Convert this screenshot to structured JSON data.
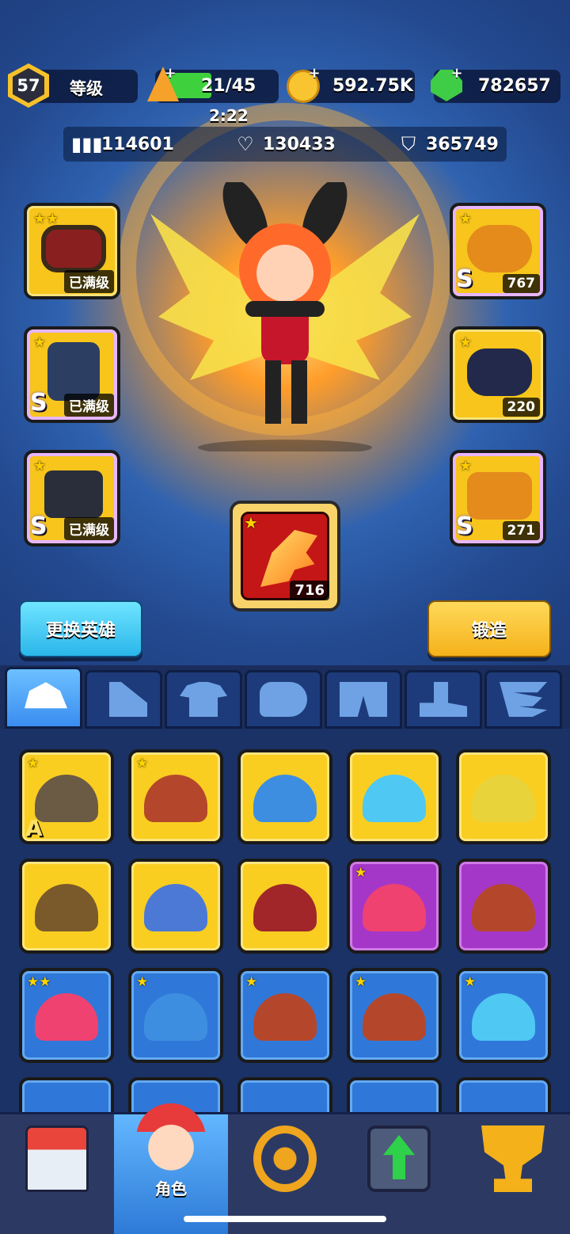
{
  "header": {
    "level": "57",
    "level_label": "等级",
    "energy": "21/45",
    "energy_fill_fraction": 0.47,
    "energy_timer": "2:22",
    "coins": "592.75K",
    "gems": "782657"
  },
  "stats": {
    "attack": "114601",
    "health": "130433",
    "defense": "365749"
  },
  "equipment": {
    "left": [
      {
        "name": "goggles",
        "stars": "★★",
        "tag": "已满级",
        "grade": ""
      },
      {
        "name": "vest",
        "stars": "★",
        "tag": "已满级",
        "grade": "S"
      },
      {
        "name": "belt",
        "stars": "★",
        "tag": "已满级",
        "grade": "S"
      }
    ],
    "right": [
      {
        "name": "helmet",
        "stars": "★",
        "tag": "767",
        "grade": "S"
      },
      {
        "name": "gloves",
        "stars": "★",
        "tag": "220",
        "grade": ""
      },
      {
        "name": "boots",
        "stars": "★",
        "tag": "271",
        "grade": "S"
      }
    ],
    "weapon": {
      "stars": "★",
      "tag": "716"
    }
  },
  "buttons": {
    "change_hero": "更换英雄",
    "forge": "锻造"
  },
  "tabs": [
    "hat",
    "shirt-left",
    "shirt",
    "gloves",
    "pants",
    "boots",
    "wings"
  ],
  "inventory": [
    {
      "rarity": "yellow",
      "item": "army-helmet",
      "stars": "★",
      "grade": "A"
    },
    {
      "rarity": "yellow",
      "item": "cowboy-hat",
      "stars": "★",
      "grade": ""
    },
    {
      "rarity": "yellow",
      "item": "police-cap",
      "stars": "",
      "grade": ""
    },
    {
      "rarity": "yellow",
      "item": "ski-goggles",
      "stars": "",
      "grade": ""
    },
    {
      "rarity": "yellow",
      "item": "miner-helmet",
      "stars": "",
      "grade": ""
    },
    {
      "rarity": "yellow",
      "item": "steampunk-goggles",
      "stars": "",
      "grade": ""
    },
    {
      "rarity": "yellow",
      "item": "swat-helmet",
      "stars": "",
      "grade": ""
    },
    {
      "rarity": "yellow",
      "item": "red-goggles",
      "stars": "",
      "grade": ""
    },
    {
      "rarity": "purple",
      "item": "headphones",
      "stars": "★",
      "grade": ""
    },
    {
      "rarity": "purple",
      "item": "cowboy-hat",
      "stars": "",
      "grade": ""
    },
    {
      "rarity": "blue",
      "item": "headphones",
      "stars": "★★",
      "grade": ""
    },
    {
      "rarity": "blue",
      "item": "police-cap",
      "stars": "★",
      "grade": ""
    },
    {
      "rarity": "blue",
      "item": "cowboy-hat",
      "stars": "★",
      "grade": ""
    },
    {
      "rarity": "blue",
      "item": "cowboy-hat",
      "stars": "★",
      "grade": ""
    },
    {
      "rarity": "blue",
      "item": "ski-goggles",
      "stars": "★",
      "grade": ""
    }
  ],
  "nav": {
    "items": [
      {
        "name": "shop",
        "label": ""
      },
      {
        "name": "character",
        "label": "角色"
      },
      {
        "name": "battle",
        "label": ""
      },
      {
        "name": "upgrade",
        "label": ""
      },
      {
        "name": "trophy",
        "label": ""
      }
    ]
  },
  "colors": {
    "gold": "#f9ce21",
    "purple": "#a437c8",
    "blue": "#2f78d9",
    "accent_blue_button": "#2ab6ea",
    "accent_yellow_button": "#f5b21a"
  }
}
